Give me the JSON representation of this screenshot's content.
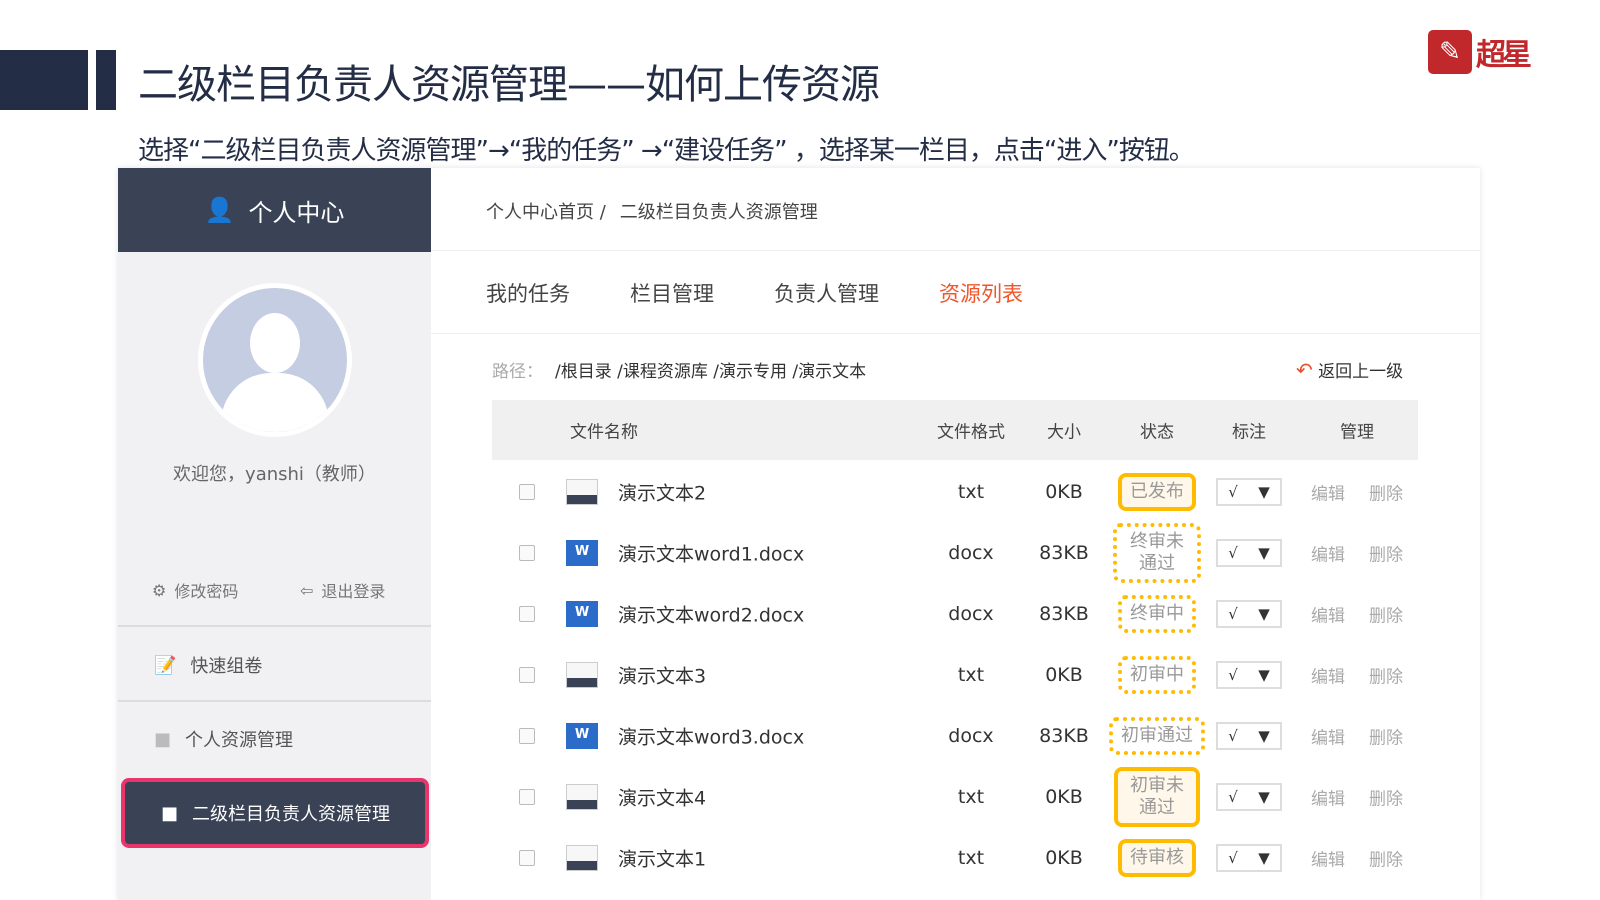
{
  "slide": {
    "title": "二级栏目负责人资源管理——如何上传资源",
    "subtitle": "选择“二级栏目负责人资源管理”→“我的任务” →“建设任务” ，选择某一栏目，点击“进入”按钮。",
    "logo_text": "超星"
  },
  "sidebar": {
    "header": "个人中心",
    "welcome": "欢迎您，yanshi（教师）",
    "change_password": "修改密码",
    "logout": "退出登录",
    "items": [
      {
        "label": "快速组卷"
      },
      {
        "label": "个人资源管理"
      },
      {
        "label": "二级栏目负责人资源管理"
      }
    ]
  },
  "breadcrumb": {
    "home": "个人中心首页 /",
    "current": "二级栏目负责人资源管理"
  },
  "tabs": [
    {
      "label": "我的任务"
    },
    {
      "label": "栏目管理"
    },
    {
      "label": "负责人管理"
    },
    {
      "label": "资源列表"
    }
  ],
  "path": {
    "label": "路径：",
    "value": "/根目录 /课程资源库 /演示专用 /演示文本",
    "back": "返回上一级"
  },
  "table": {
    "headers": {
      "name": "文件名称",
      "format": "文件格式",
      "size": "大小",
      "status": "状态",
      "mark": "标注",
      "manage": "管理"
    },
    "rows": [
      {
        "name": "演示文本2",
        "type": "txt",
        "format": "txt",
        "size": "0KB",
        "status": "已发布",
        "mark": "√",
        "edit": "编辑",
        "delete": "删除"
      },
      {
        "name": "演示文本word1.docx",
        "type": "word",
        "format": "docx",
        "size": "83KB",
        "status": "终审未通过",
        "mark": "√",
        "edit": "编辑",
        "delete": "删除"
      },
      {
        "name": "演示文本word2.docx",
        "type": "word",
        "format": "docx",
        "size": "83KB",
        "status": "终审中",
        "mark": "√",
        "edit": "编辑",
        "delete": "删除"
      },
      {
        "name": "演示文本3",
        "type": "txt",
        "format": "txt",
        "size": "0KB",
        "status": "初审中",
        "mark": "√",
        "edit": "编辑",
        "delete": "删除"
      },
      {
        "name": "演示文本word3.docx",
        "type": "word",
        "format": "docx",
        "size": "83KB",
        "status": "初审通过",
        "mark": "√",
        "edit": "编辑",
        "delete": "删除"
      },
      {
        "name": "演示文本4",
        "type": "txt",
        "format": "txt",
        "size": "0KB",
        "status": "初审未通过",
        "mark": "√",
        "edit": "编辑",
        "delete": "删除"
      },
      {
        "name": "演示文本1",
        "type": "txt",
        "format": "txt",
        "size": "0KB",
        "status": "待审核",
        "mark": "√",
        "edit": "编辑",
        "delete": "删除"
      }
    ]
  },
  "colors": {
    "accent": "#f0562a",
    "highlight": "#ffbb00",
    "dark": "#3a4256",
    "active_border": "#e8356b"
  }
}
